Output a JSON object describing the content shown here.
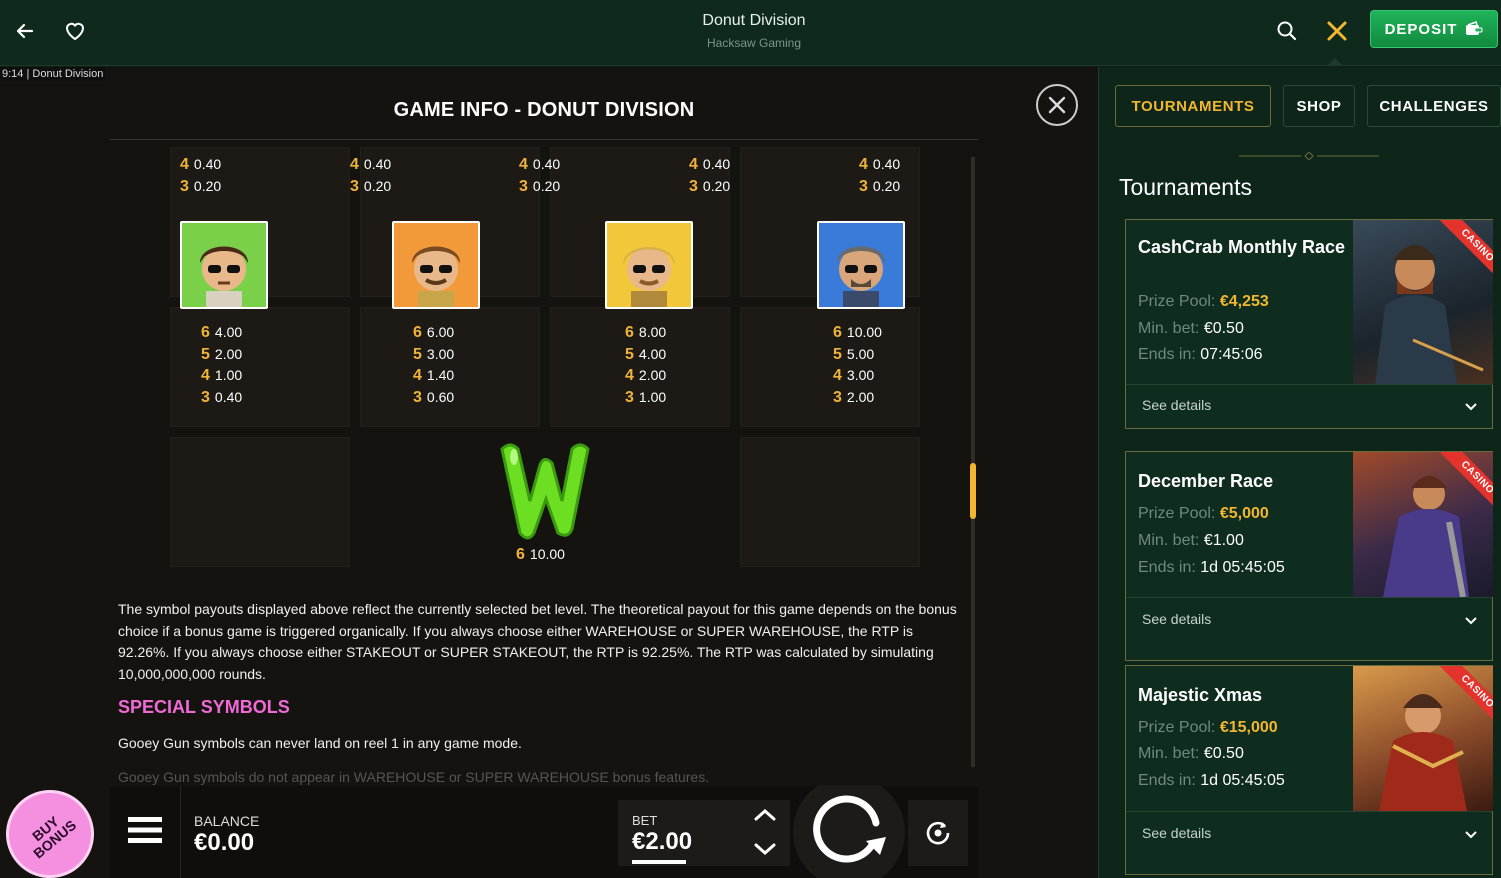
{
  "header": {
    "title": "Donut Division",
    "subtitle": "Hacksaw Gaming",
    "deposit_label": "DEPOSIT"
  },
  "game": {
    "tag_time": "9:14",
    "tag_name": "Donut Division",
    "info_title": "GAME INFO - DONUT DIVISION",
    "top_pays": [
      [
        {
          "n": "4",
          "v": "0.40"
        },
        {
          "n": "3",
          "v": "0.20"
        }
      ],
      [
        {
          "n": "4",
          "v": "0.40"
        },
        {
          "n": "3",
          "v": "0.20"
        }
      ],
      [
        {
          "n": "4",
          "v": "0.40"
        },
        {
          "n": "3",
          "v": "0.20"
        }
      ],
      [
        {
          "n": "4",
          "v": "0.40"
        },
        {
          "n": "3",
          "v": "0.20"
        }
      ],
      [
        {
          "n": "4",
          "v": "0.40"
        },
        {
          "n": "3",
          "v": "0.20"
        }
      ]
    ],
    "symbols": [
      {
        "icon": "detective-green-symbol-icon",
        "pays": [
          {
            "n": "6",
            "v": "4.00"
          },
          {
            "n": "5",
            "v": "2.00"
          },
          {
            "n": "4",
            "v": "1.00"
          },
          {
            "n": "3",
            "v": "0.40"
          }
        ]
      },
      {
        "icon": "detective-orange-symbol-icon",
        "pays": [
          {
            "n": "6",
            "v": "6.00"
          },
          {
            "n": "5",
            "v": "3.00"
          },
          {
            "n": "4",
            "v": "1.40"
          },
          {
            "n": "3",
            "v": "0.60"
          }
        ]
      },
      {
        "icon": "detective-yellow-symbol-icon",
        "pays": [
          {
            "n": "6",
            "v": "8.00"
          },
          {
            "n": "5",
            "v": "4.00"
          },
          {
            "n": "4",
            "v": "2.00"
          },
          {
            "n": "3",
            "v": "1.00"
          }
        ]
      },
      {
        "icon": "detective-blue-symbol-icon",
        "pays": [
          {
            "n": "6",
            "v": "10.00"
          },
          {
            "n": "5",
            "v": "5.00"
          },
          {
            "n": "4",
            "v": "3.00"
          },
          {
            "n": "3",
            "v": "2.00"
          }
        ]
      }
    ],
    "wild": {
      "icon": "wild-w-symbol-icon",
      "n": "6",
      "v": "10.00"
    },
    "description": "The symbol payouts displayed above reflect the currently selected bet level. The theoretical payout for this game depends on the bonus choice if a bonus game is triggered organically. If you always choose either WAREHOUSE or SUPER WAREHOUSE, the RTP is 92.26%. If you always choose either STAKEOUT or SUPER STAKEOUT, the RTP is 92.25%. The RTP was calculated by simulating 10,000,000,000 rounds.",
    "special_heading": "SPECIAL SYMBOLS",
    "special_text": "Gooey Gun symbols can never land on reel 1 in any game mode.",
    "faded_text": "Gooey Gun symbols do not appear in WAREHOUSE or SUPER WAREHOUSE bonus features.",
    "balance_label": "BALANCE",
    "balance_value": "€0.00",
    "bet_label": "BET",
    "bet_value": "€2.00",
    "buy_bonus_label": "BUY BONUS"
  },
  "sidebar": {
    "tabs": [
      "TOURNAMENTS",
      "SHOP",
      "CHALLENGES"
    ],
    "active_tab": "TOURNAMENTS",
    "heading": "Tournaments",
    "labels": {
      "prize": "Prize Pool:",
      "minbet": "Min. bet:",
      "ends": "Ends in:",
      "details": "See details",
      "ribbon": "CASINO"
    },
    "cards": [
      {
        "title": "CashCrab Monthly Race",
        "prize": "€4,253",
        "minbet": "€0.50",
        "ends": "07:45:06"
      },
      {
        "title": "December Race",
        "prize": "€5,000",
        "minbet": "€1.00",
        "ends": "1d 05:45:05"
      },
      {
        "title": "Majestic Xmas",
        "prize": "€15,000",
        "minbet": "€0.50",
        "ends": "1d 05:45:05"
      }
    ]
  },
  "colors": {
    "accent_gold": "#f2b630",
    "deposit_green": "#1fb35a",
    "special_pink": "#f06ad6",
    "ribbon_red": "#e3332c"
  }
}
